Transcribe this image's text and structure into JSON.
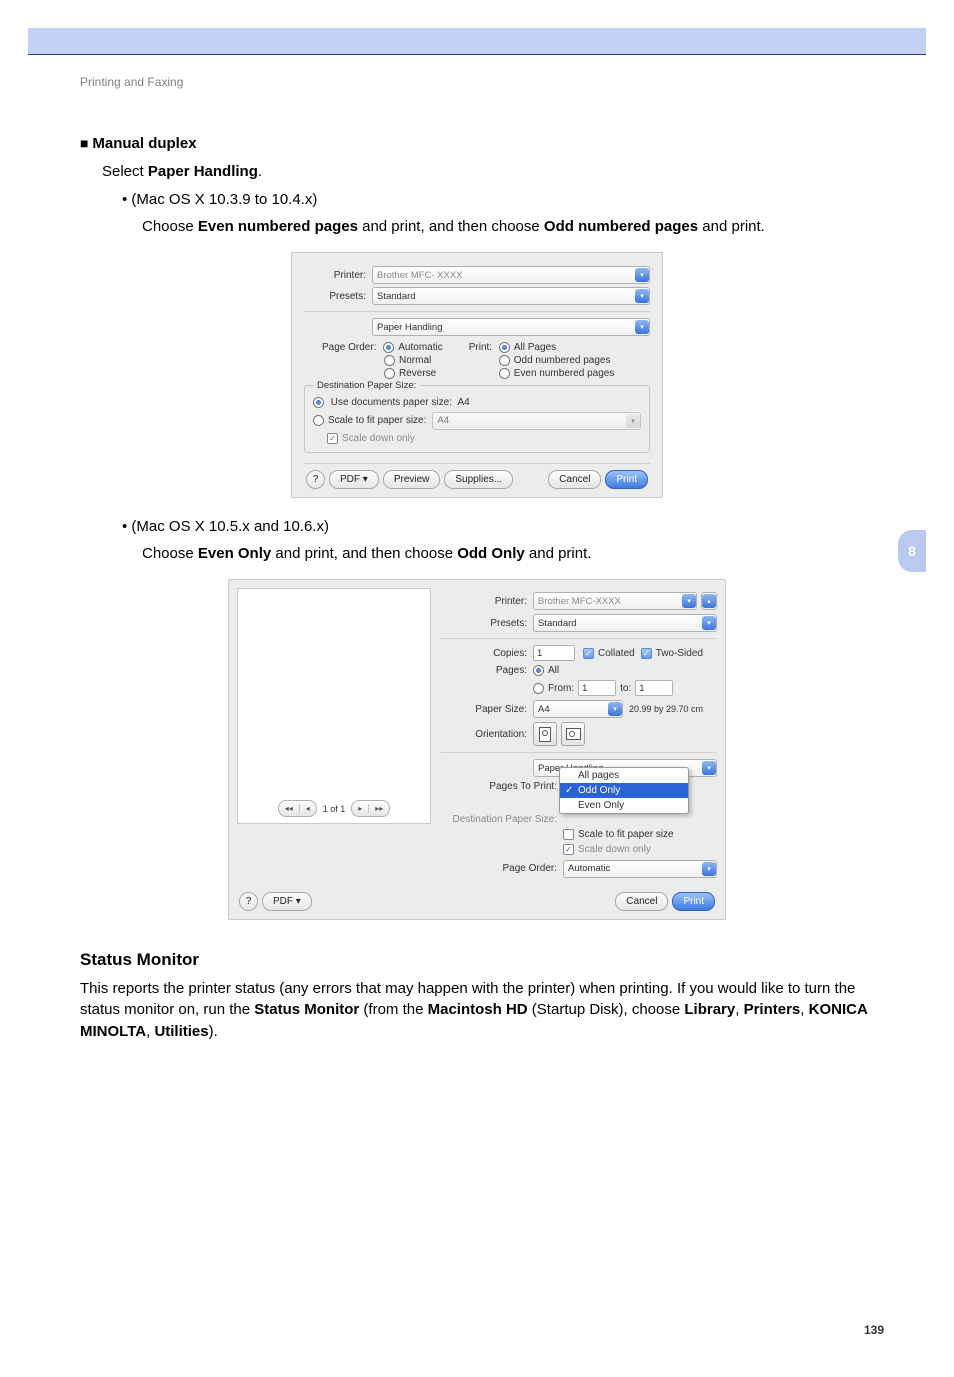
{
  "breadcrumb": "Printing and Faxing",
  "page_number": "139",
  "side_tab": "8",
  "sec1": {
    "title": "Manual duplex",
    "line1_a": "Select ",
    "line1_b": "Paper Handling",
    "line1_c": ".",
    "os104": "(Mac OS X 10.3.9 to 10.4.x)",
    "inst104_a": "Choose ",
    "inst104_b": "Even numbered pages",
    "inst104_c": " and print, and then choose ",
    "inst104_d": "Odd numbered pages",
    "inst104_e": " and print.",
    "os105": "(Mac OS X 10.5.x and 10.6.x)",
    "inst105_a": "Choose ",
    "inst105_b": "Even Only",
    "inst105_c": " and print, and then choose ",
    "inst105_d": "Odd Only",
    "inst105_e": " and print."
  },
  "sec2": {
    "title": "Status Monitor",
    "body_a": "This reports the printer status (any errors that may happen with the printer) when printing. If you would like to turn the status monitor on, run the ",
    "body_b": "Status Monitor",
    "body_c": " (from the ",
    "body_d": "Macintosh HD",
    "body_e": " (Startup Disk), choose ",
    "body_f": "Library",
    "body_g": ", ",
    "body_h": "Printers",
    "body_i": ", ",
    "body_j": "KONICA MINOLTA",
    "body_k": ", ",
    "body_l": "Utilities",
    "body_m": ")."
  },
  "dlg1": {
    "printer_lbl": "Printer:",
    "printer_val": "Brother MFC- XXXX",
    "presets_lbl": "Presets:",
    "presets_val": "Standard",
    "panel_val": "Paper Handling",
    "page_order_lbl": "Page Order:",
    "po_auto": "Automatic",
    "po_normal": "Normal",
    "po_reverse": "Reverse",
    "print_lbl": "Print:",
    "pr_all": "All Pages",
    "pr_odd": "Odd numbered pages",
    "pr_even": "Even numbered pages",
    "dest_title": "Destination Paper Size:",
    "use_doc": "Use documents paper size:",
    "use_doc_val": "A4",
    "scale_fit": "Scale to fit paper size:",
    "scale_fit_val": "A4",
    "scale_down": "Scale down only",
    "help": "?",
    "pdf": "PDF ▾",
    "preview": "Preview",
    "supplies": "Supplies...",
    "cancel": "Cancel",
    "print": "Print"
  },
  "dlg2": {
    "printer_lbl": "Printer:",
    "printer_val": "Brother MFC-XXXX",
    "presets_lbl": "Presets:",
    "presets_val": "Standard",
    "copies_lbl": "Copies:",
    "copies_val": "1",
    "collated": "Collated",
    "two_sided": "Two-Sided",
    "pages_lbl": "Pages:",
    "pages_all": "All",
    "pages_from": "From:",
    "pages_from_val": "1",
    "pages_to": "to:",
    "pages_to_val": "1",
    "paper_size_lbl": "Paper Size:",
    "paper_size_val": "A4",
    "paper_dim": "20.99 by 29.70 cm",
    "orientation_lbl": "Orientation:",
    "panel_val": "Paper Handling",
    "pages_to_print_lbl": "Pages To Print:",
    "menu_all": "All pages",
    "menu_odd": "Odd Only",
    "menu_even": "Even Only",
    "dest_lbl": "Destination Paper Size:",
    "scale_fit": "Scale to fit paper size",
    "scale_down": "Scale down only",
    "page_order_lbl": "Page Order:",
    "page_order_val": "Automatic",
    "nav_count": "1 of 1",
    "help": "?",
    "pdf": "PDF ▾",
    "cancel": "Cancel",
    "print": "Print",
    "collapse": "▴"
  }
}
